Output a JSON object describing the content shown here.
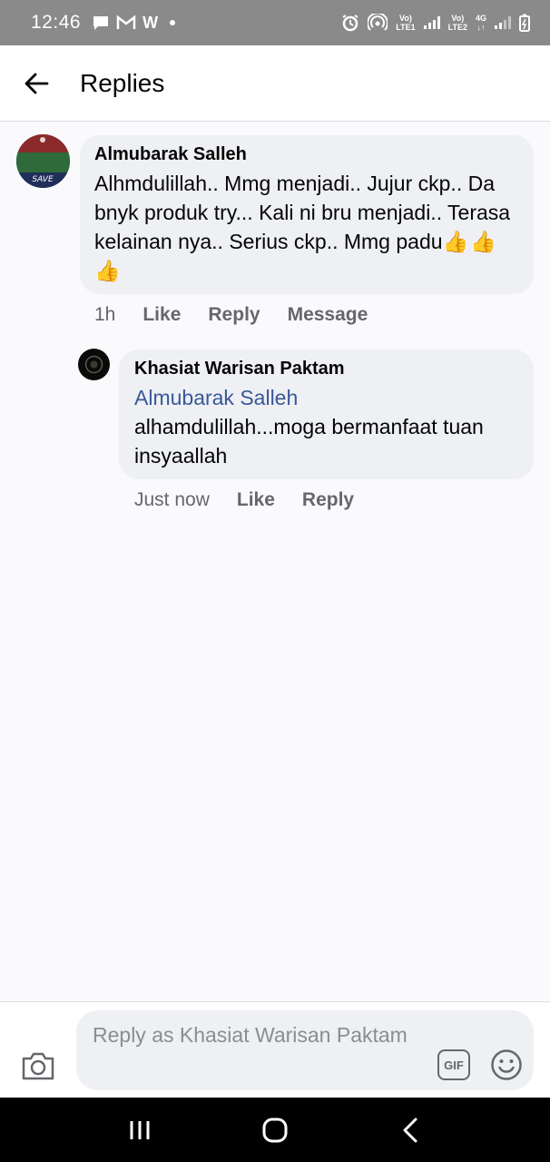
{
  "status_bar": {
    "time": "12:46",
    "left_icons": [
      "chat-icon",
      "gmail-icon",
      "w-icon",
      "dot-icon"
    ],
    "w_label": "W",
    "sim1_label": "Vo)\nLTE1",
    "sim2_label": "Vo)\nLTE2",
    "network_label": "4G"
  },
  "header": {
    "title": "Replies"
  },
  "comments": [
    {
      "author": "Almubarak Salleh",
      "text": "Alhmdulillah.. Mmg menjadi.. Jujur ckp.. Da bnyk produk try... Kali ni bru menjadi.. Terasa kelainan nya.. Serius ckp.. Mmg padu",
      "emoji": "👍👍👍",
      "time": "1h",
      "like_label": "Like",
      "reply_label": "Reply",
      "message_label": "Message"
    },
    {
      "author": "Khasiat Warisan Paktam",
      "mention": "Almubarak Salleh",
      "text": "alhamdulillah...moga bermanfaat tuan insyaallah",
      "time": "Just now",
      "like_label": "Like",
      "reply_label": "Reply"
    }
  ],
  "composer": {
    "placeholder": "Reply as Khasiat Warisan Paktam",
    "gif_label": "GIF"
  },
  "colors": {
    "status_bar": "#8a8a8a",
    "bubble": "#eef0f3",
    "mention": "#385898",
    "action_text": "#65676b"
  }
}
